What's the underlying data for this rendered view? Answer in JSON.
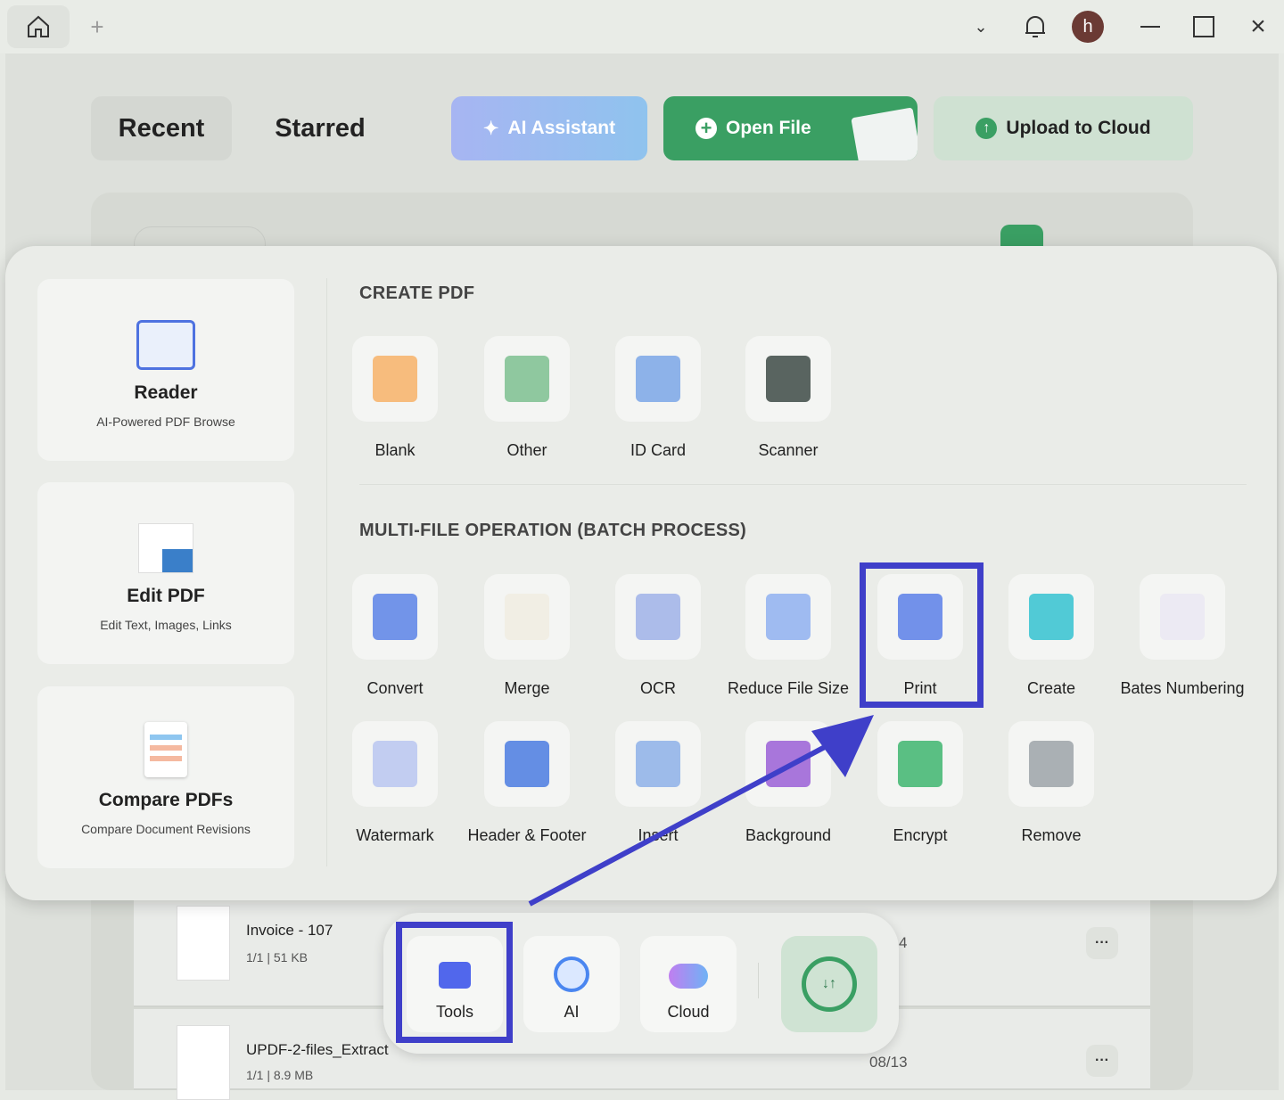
{
  "titlebar": {
    "avatar_letter": "h"
  },
  "nav": {
    "recent": "Recent",
    "starred": "Starred",
    "ai_assistant": "AI Assistant",
    "open_file": "Open File",
    "upload": "Upload to Cloud"
  },
  "files": [
    {
      "name": "Invoice - 107",
      "meta": "1/1 | 51 KB",
      "date": "4"
    },
    {
      "name": "UPDF-2-files_Extract",
      "meta": "1/1 | 8.9 MB",
      "date": "08/13"
    }
  ],
  "panel": {
    "cards": [
      {
        "title": "Reader",
        "subtitle": "AI-Powered PDF Browse"
      },
      {
        "title": "Edit PDF",
        "subtitle": "Edit Text, Images, Links"
      },
      {
        "title": "Compare PDFs",
        "subtitle": "Compare Document Revisions"
      }
    ],
    "create_title": "CREATE PDF",
    "create": [
      "Blank",
      "Other",
      "ID Card",
      "Scanner"
    ],
    "batch_title": "MULTI-FILE OPERATION (BATCH PROCESS)",
    "batch": [
      "Convert",
      "Merge",
      "OCR",
      "Reduce File Size",
      "Print",
      "Create",
      "Bates Numbering",
      "Watermark",
      "Header & Footer",
      "Insert",
      "Background",
      "Encrypt",
      "Remove"
    ]
  },
  "dock": {
    "tools": "Tools",
    "ai": "AI",
    "cloud": "Cloud"
  },
  "colors": {
    "highlight": "#3f3fc9",
    "green": "#3a9f63",
    "ai_gradient": "#8fa6f5"
  }
}
